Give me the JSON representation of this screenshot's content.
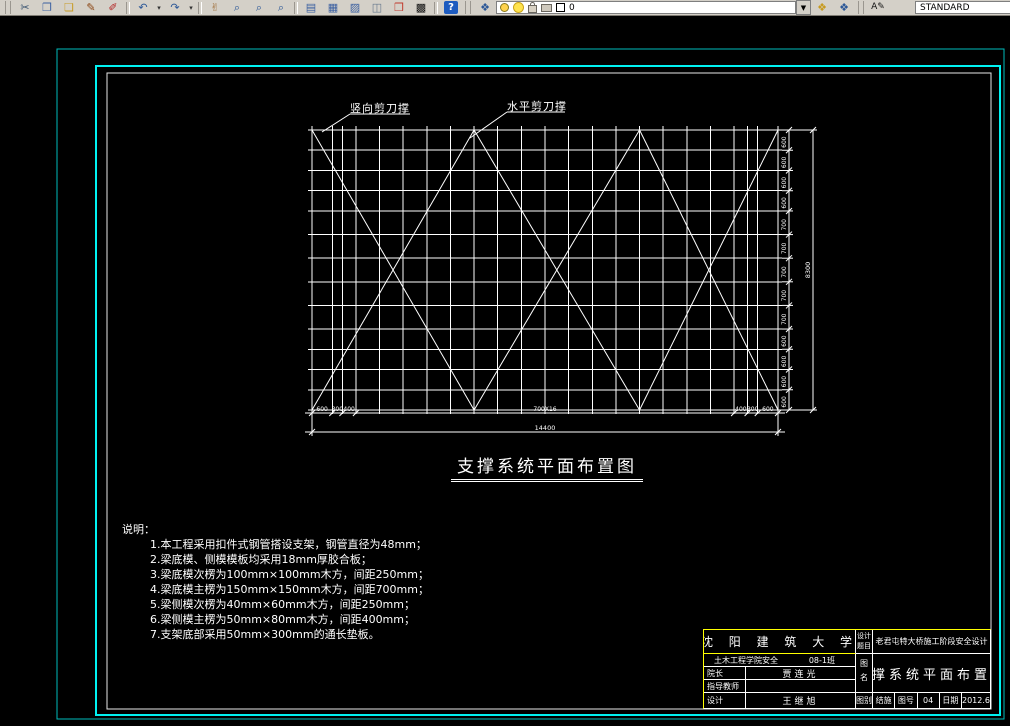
{
  "colors": {
    "background": "#000000",
    "line": "#ffffff",
    "frame_cyan": "#00f2f2",
    "accent_yellow": "#ffff00",
    "toolbar_bg": "#d4d0c8"
  },
  "toolbar": {
    "layer_combo": {
      "layer_name": "0"
    },
    "text_style_combo": {
      "value": "STANDARD"
    },
    "items": [
      {
        "t": "grip",
        "name": "toolbar-grip"
      },
      {
        "t": "btn",
        "name": "cut-icon",
        "g": "✂",
        "c": "#36506e"
      },
      {
        "t": "btn",
        "name": "copy-icon",
        "g": "❐",
        "c": "#3a5fa0"
      },
      {
        "t": "btn",
        "name": "paste-icon",
        "g": "❏",
        "c": "#c79a1f"
      },
      {
        "t": "btn",
        "name": "brush-icon",
        "g": "✎",
        "c": "#8b4513"
      },
      {
        "t": "btn",
        "name": "match-properties-icon",
        "g": "✐",
        "c": "#b22222"
      },
      {
        "t": "sep"
      },
      {
        "t": "btn",
        "name": "undo-icon",
        "g": "↶",
        "c": "#2b5797"
      },
      {
        "t": "dd",
        "name": "undo-dropdown-icon",
        "g": "▾"
      },
      {
        "t": "btn",
        "name": "redo-icon",
        "g": "↷",
        "c": "#2b5797"
      },
      {
        "t": "dd",
        "name": "redo-dropdown-icon",
        "g": "▾"
      },
      {
        "t": "sep"
      },
      {
        "t": "btn",
        "name": "pan-icon",
        "g": "✌",
        "c": "#a0703c"
      },
      {
        "t": "btn",
        "name": "zoom-realtime-icon",
        "g": "⌕",
        "c": "#2b5797"
      },
      {
        "t": "btn",
        "name": "zoom-window-icon",
        "g": "⌕",
        "c": "#2b5797"
      },
      {
        "t": "btn",
        "name": "zoom-previous-icon",
        "g": "⌕",
        "c": "#2b5797"
      },
      {
        "t": "sep"
      },
      {
        "t": "btn",
        "name": "palettes-icon",
        "g": "▤",
        "c": "#3a5fa0"
      },
      {
        "t": "btn",
        "name": "layer-manager-icon",
        "g": "▦",
        "c": "#3a5fa0"
      },
      {
        "t": "btn",
        "name": "layout-icon",
        "g": "▨",
        "c": "#3a5fa0"
      },
      {
        "t": "btn",
        "name": "views-icon",
        "g": "◫",
        "c": "#66788c"
      },
      {
        "t": "btn",
        "name": "sheets-icon",
        "g": "❒",
        "c": "#c0392b"
      },
      {
        "t": "btn",
        "name": "calculator-icon",
        "g": "▩",
        "c": "#111111"
      },
      {
        "t": "sep"
      },
      {
        "t": "help",
        "name": "help-icon",
        "g": "?"
      },
      {
        "t": "grip",
        "name": "toolbar-grip"
      },
      {
        "t": "btn",
        "name": "layers-icon",
        "g": "❖",
        "c": "#2b5797"
      },
      {
        "t": "layerfield",
        "name": "layer-combo"
      },
      {
        "t": "comboarrow",
        "name": "layer-combo-dropdown-icon",
        "g": "▼"
      },
      {
        "t": "btn",
        "name": "make-layer-current-icon",
        "g": "❖",
        "c": "#c79a1f"
      },
      {
        "t": "btn",
        "name": "layer-previous-icon",
        "g": "❖",
        "c": "#2b5797"
      },
      {
        "t": "grip",
        "name": "toolbar-grip"
      },
      {
        "t": "btn",
        "name": "text-style-icon",
        "g": "A✎",
        "c": "#111111"
      },
      {
        "t": "textcombo",
        "name": "text-style-combo"
      },
      {
        "t": "overflow",
        "name": "toolbar-overflow-icon",
        "g": "▸"
      }
    ]
  },
  "drawing": {
    "labels": {
      "vertical_brace": "竖向剪刀撑",
      "horizontal_brace": "水平剪刀撑"
    },
    "title": "支撑系统平面布置图",
    "grid": {
      "col_modules": [
        600,
        300,
        400,
        700,
        700,
        700,
        700,
        700,
        700,
        700,
        700,
        700,
        700,
        700,
        700,
        700,
        700,
        700,
        700,
        400,
        300,
        600
      ],
      "row_modules": [
        600,
        600,
        600,
        600,
        700,
        700,
        700,
        700,
        700,
        600,
        600,
        600,
        600
      ]
    },
    "dims": {
      "bottom_segments_left": [
        "600",
        "300",
        "400"
      ],
      "bottom_middle": "700X16",
      "bottom_segments_right": [
        "400",
        "300",
        "600"
      ],
      "bottom_total": "14400",
      "right_segments": [
        "600",
        "600",
        "600",
        "600",
        "700",
        "700",
        "700",
        "700",
        "700",
        "600",
        "600",
        "600",
        "600"
      ],
      "right_total": "8300"
    }
  },
  "notes": {
    "heading": "说明：",
    "items": [
      "1.本工程采用扣件式钢管搭设支架，钢管直径为48mm；",
      "2.梁底模、侧模模板均采用18mm厚胶合板；",
      "3.梁底模次楞为100mm×100mm木方，间距250mm；",
      "4.梁底模主楞为150mm×150mm木方，间距700mm；",
      "5.梁侧模次楞为40mm×60mm木方，间距250mm；",
      "6.梁侧模主楞为50mm×80mm木方，间距400mm；",
      "7.支架底部采用50mm×300mm的通长垫板。"
    ]
  },
  "title_block": {
    "university": "沈 阳 建 筑 大 学",
    "department": "土木工程学院安全",
    "class_name": "08-1班",
    "rows": [
      {
        "label": "院长",
        "value": "贾连光"
      },
      {
        "label": "指导教师",
        "value": ""
      },
      {
        "label": "设计",
        "value": "王继旭"
      }
    ],
    "project_label": "设计题目",
    "project": "老君屯特大桥施工阶段安全设计",
    "drawing_name_label": "图名",
    "drawing_name": "支撑系统平面布置图",
    "bottom": {
      "type_label": "图别",
      "type": "结施",
      "no_label": "图号",
      "no": "04",
      "date_label": "日期",
      "date": "2012.6"
    }
  }
}
